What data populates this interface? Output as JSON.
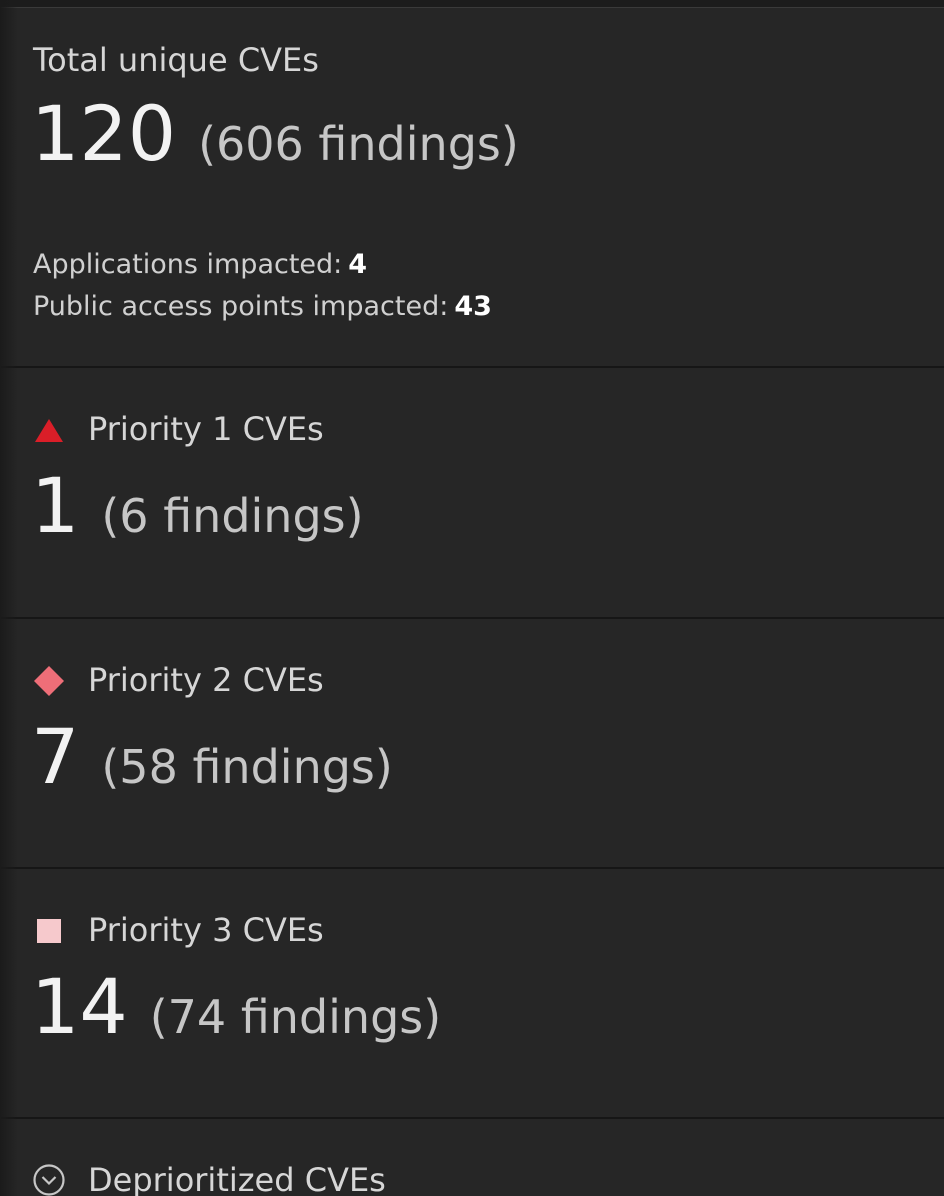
{
  "total": {
    "title": "Total unique CVEs",
    "count": "120",
    "findings": "(606 findings)",
    "applications_label": "Applications impacted:",
    "applications_value": "4",
    "public_access_label": "Public access points impacted:",
    "public_access_value": "43"
  },
  "priority1": {
    "title": "Priority 1 CVEs",
    "count": "1",
    "findings": "(6 findings)",
    "icon": "triangle-icon",
    "color": "#da1e28"
  },
  "priority2": {
    "title": "Priority 2 CVEs",
    "count": "7",
    "findings": "(58 findings)",
    "icon": "diamond-icon",
    "color": "#ee6e78"
  },
  "priority3": {
    "title": "Priority 3 CVEs",
    "count": "14",
    "findings": "(74 findings)",
    "icon": "square-icon",
    "color": "#f6c9cc"
  },
  "deprioritized": {
    "title": "Deprioritized CVEs",
    "icon": "chevron-down-circle-icon"
  }
}
